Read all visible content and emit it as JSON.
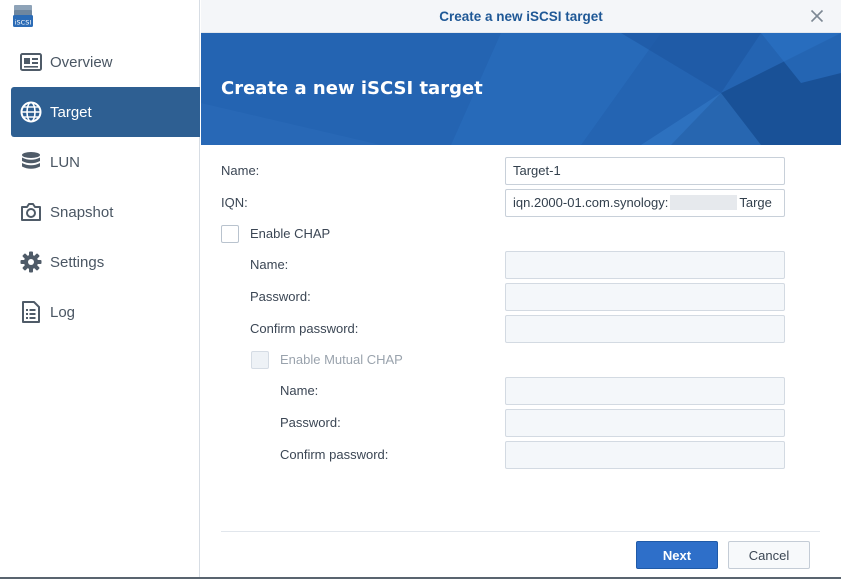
{
  "app": {
    "icon_label": "iSCSI"
  },
  "sidebar": {
    "items": [
      {
        "label": "Overview",
        "icon": "overview-icon"
      },
      {
        "label": "Target",
        "icon": "globe-icon"
      },
      {
        "label": "LUN",
        "icon": "database-icon"
      },
      {
        "label": "Snapshot",
        "icon": "camera-icon"
      },
      {
        "label": "Settings",
        "icon": "gear-icon"
      },
      {
        "label": "Log",
        "icon": "log-list-icon"
      }
    ],
    "active": "Target"
  },
  "dialog": {
    "window_title": "Create a new iSCSI target",
    "banner_title": "Create a new iSCSI target",
    "close_icon": "close-icon",
    "fields": {
      "name_label": "Name:",
      "name_value": "Target-1",
      "iqn_label": "IQN:",
      "iqn_prefix": "iqn.2000-01.com.synology:",
      "iqn_suffix": "Targe",
      "enable_chap_label": "Enable CHAP",
      "enable_chap_checked": false,
      "chap": {
        "name_label": "Name:",
        "name_value": "",
        "password_label": "Password:",
        "password_value": "",
        "confirm_label": "Confirm password:",
        "confirm_value": ""
      },
      "enable_mutual_chap_label": "Enable Mutual CHAP",
      "enable_mutual_chap_checked": false,
      "mutual": {
        "name_label": "Name:",
        "name_value": "",
        "password_label": "Password:",
        "password_value": "",
        "confirm_label": "Confirm password:",
        "confirm_value": ""
      }
    },
    "buttons": {
      "next_label": "Next",
      "cancel_label": "Cancel"
    }
  },
  "colors": {
    "accent": "#2e5f92",
    "banner": "#2566b4",
    "primary_button": "#2e6fc9",
    "title_text": "#1f5896"
  }
}
